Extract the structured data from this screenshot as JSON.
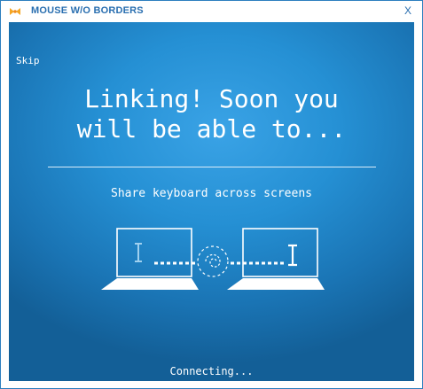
{
  "window": {
    "title": "MOUSE W/O BORDERS",
    "close_label": "X"
  },
  "content": {
    "skip_label": "Skip",
    "headline": "Linking! Soon you\nwill be able to...",
    "feature_text": "Share keyboard across screens",
    "status_text": "Connecting..."
  },
  "colors": {
    "accent": "#2a6fb0",
    "background_light": "#3aa3e6",
    "background_dark": "#135f97"
  },
  "icons": {
    "app_logo": "mouse-without-borders-logo",
    "left_laptop": "laptop-icon",
    "right_laptop": "laptop-icon",
    "link": "swirl-link-icon",
    "cursor": "text-cursor-icon"
  }
}
